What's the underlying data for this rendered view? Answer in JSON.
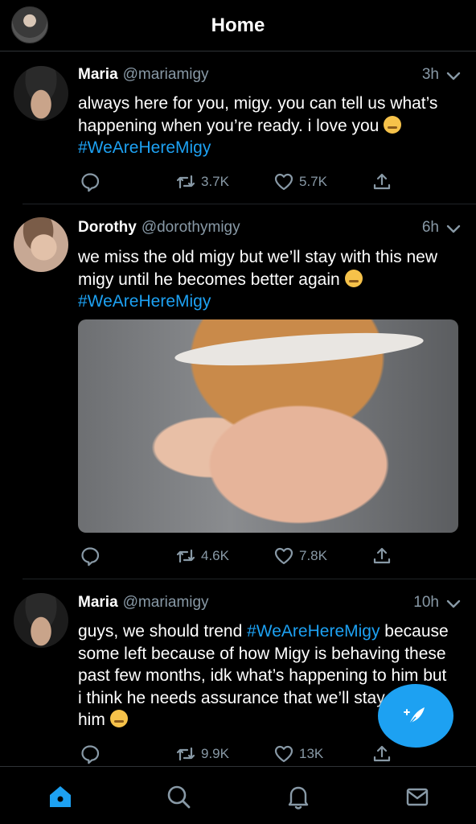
{
  "header": {
    "title": "Home"
  },
  "tweets": [
    {
      "name": "Maria",
      "handle": "@mariamigy",
      "time": "3h",
      "text_pre": "always here for you, migy. you can tell us what’s happening when you’re ready. i love you ",
      "hashtag": "#WeAreHereMigy",
      "text_post": "",
      "retweets": "3.7K",
      "likes": "5.7K"
    },
    {
      "name": "Dorothy",
      "handle": "@dorothymigy",
      "time": "6h",
      "text_pre": "we miss the old migy but we’ll stay with this new migy until he becomes better again ",
      "hashtag": "#WeAreHereMigy",
      "text_post": "",
      "retweets": "4.6K",
      "likes": "7.8K"
    },
    {
      "name": "Maria",
      "handle": "@mariamigy",
      "time": "10h",
      "text_pre": "guys, we should trend ",
      "hashtag": "#WeAreHereMigy",
      "text_post": " because some left because of how Migy is behaving these past few months, idk what’s happening to him but i think he needs assurance that we’ll stay with him ",
      "retweets": "9.9K",
      "likes": "13K"
    }
  ],
  "icons": {
    "reply": "reply-icon",
    "retweet": "retweet-icon",
    "like": "heart-icon",
    "share": "share-icon",
    "compose": "compose-tweet-icon",
    "home": "home-icon",
    "search": "search-icon",
    "notifications": "bell-icon",
    "messages": "mail-icon"
  },
  "colors": {
    "accent": "#1da1f2",
    "muted": "#8899a6",
    "background": "#000000"
  }
}
